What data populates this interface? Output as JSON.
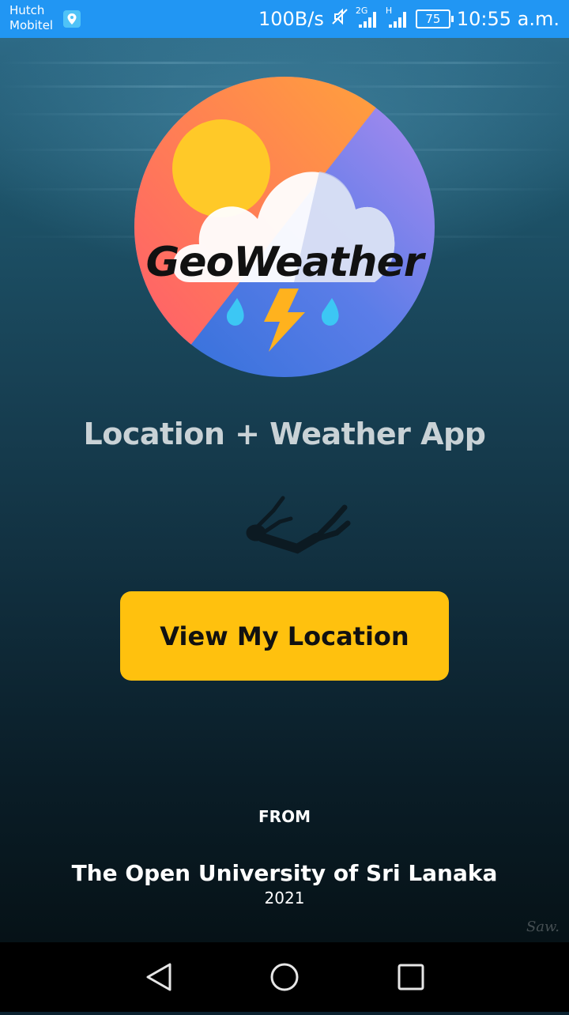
{
  "status_bar": {
    "carrier_line1": "Hutch",
    "carrier_line2": "Mobitel",
    "speed": "100B/s",
    "net_2g": "2G",
    "net_h": "H",
    "battery": "75",
    "time": "10:55 a.m."
  },
  "app": {
    "logo_title": "GeoWeather",
    "tagline": "Location + Weather App",
    "primary_button": "View My Location",
    "from_label": "FROM",
    "organization": "The Open University of Sri Lanaka",
    "year": "2021",
    "watermark": "Saw."
  },
  "colors": {
    "status_bar": "#2196F3",
    "button": "#FFC10E",
    "nav_bar": "#000000"
  },
  "nav": {
    "icons": [
      "back-icon",
      "home-icon",
      "recents-icon"
    ]
  }
}
